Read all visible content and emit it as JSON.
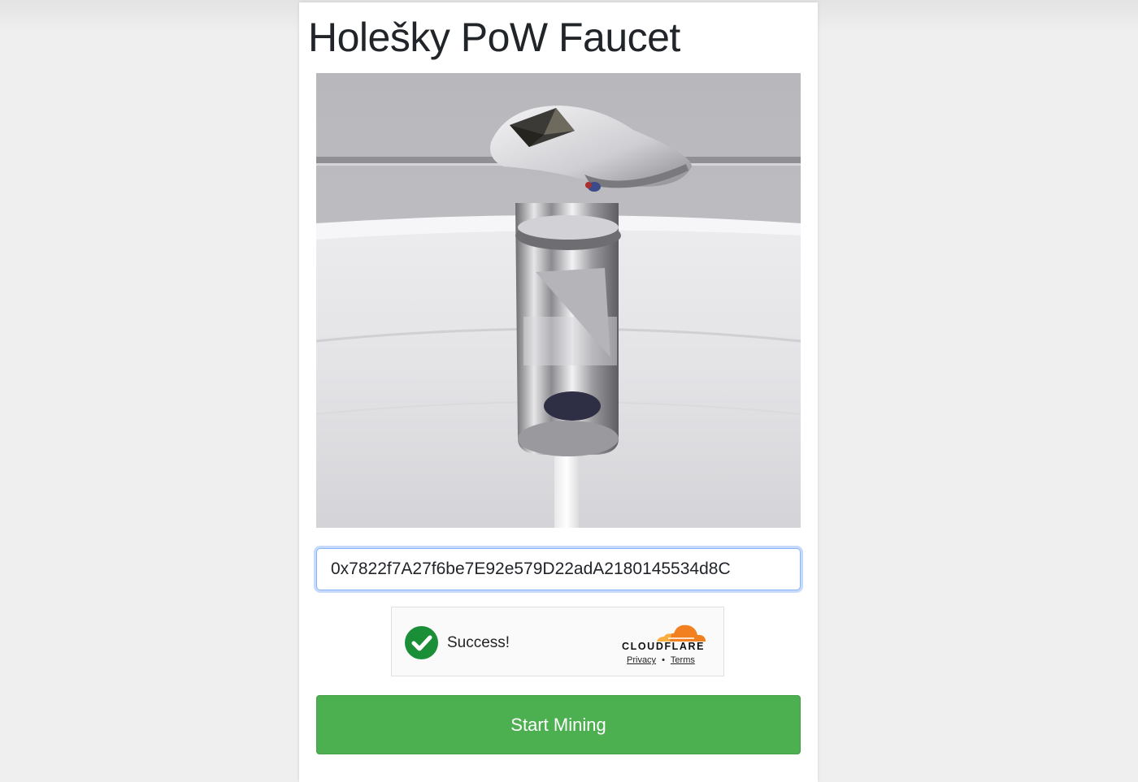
{
  "page": {
    "title": "Holešky PoW Faucet"
  },
  "address_input": {
    "value": "0x7822f7A27f6be7E92e579D22adA2180145534d8C"
  },
  "captcha": {
    "status": "Success!",
    "brand": "CLOUDFLARE",
    "privacy_link": "Privacy",
    "separator": "•",
    "terms_link": "Terms"
  },
  "actions": {
    "start_label": "Start Mining"
  },
  "colors": {
    "button": "#4caf50",
    "success_check": "#1a8f38",
    "cloudflare_orange": "#f38020",
    "input_focus": "#86b7fe"
  },
  "icons": {
    "status": "check-circle-icon",
    "brand": "cloudflare-cloud-icon",
    "hero": "ethereum-faucet-image"
  }
}
